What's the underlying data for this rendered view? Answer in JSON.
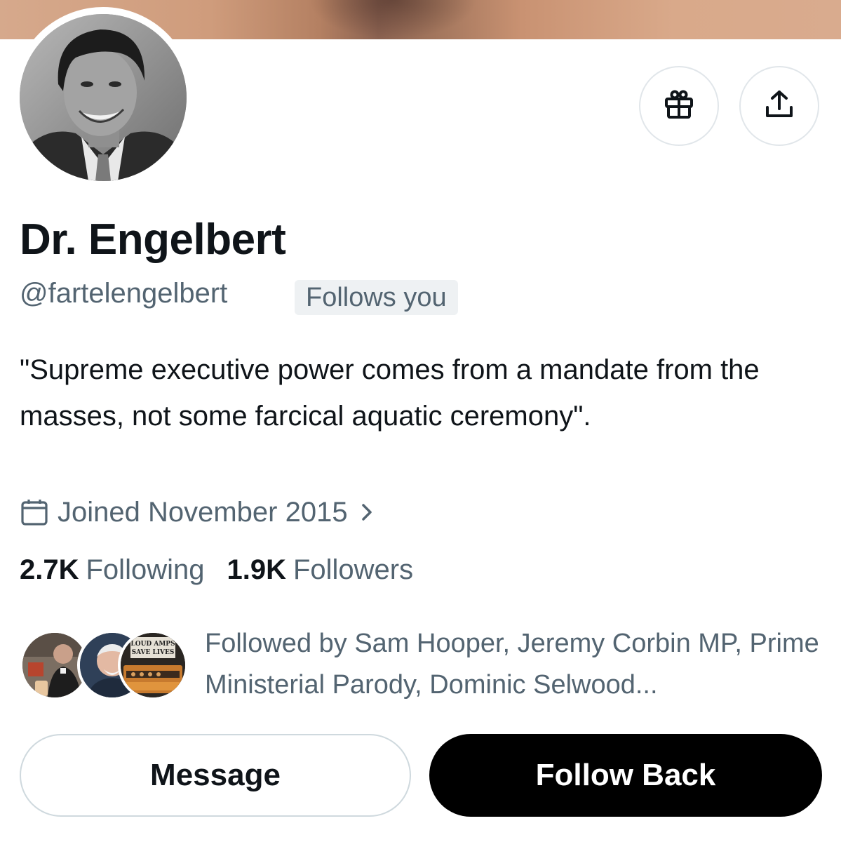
{
  "profile": {
    "display_name": "Dr. Engelbert",
    "handle": "@fartelengelbert",
    "follows_you_badge": "Follows you",
    "bio": "\"Supreme executive power comes from a mandate from the masses, not some farcical aquatic ceremony\".",
    "joined": "Joined November 2015"
  },
  "stats": {
    "following_count": "2.7K",
    "following_label": "Following",
    "followers_count": "1.9K",
    "followers_label": "Followers"
  },
  "followed_by": {
    "text": "Followed by Sam Hooper, Jeremy Corbin MP, Prime Ministerial Parody, Dominic Selwood...",
    "third_avatar_sign": "LOUD AMPS SAVE LIVES"
  },
  "actions": {
    "message_label": "Message",
    "follow_back_label": "Follow Back"
  },
  "icons": {
    "gift": "gift-icon",
    "share": "share-icon",
    "calendar": "calendar-icon",
    "chevron": "chevron-right-icon"
  },
  "colors": {
    "text_primary": "#0f1419",
    "text_secondary": "#536471",
    "follow_button_bg": "#000000",
    "border": "#cfd9de"
  }
}
